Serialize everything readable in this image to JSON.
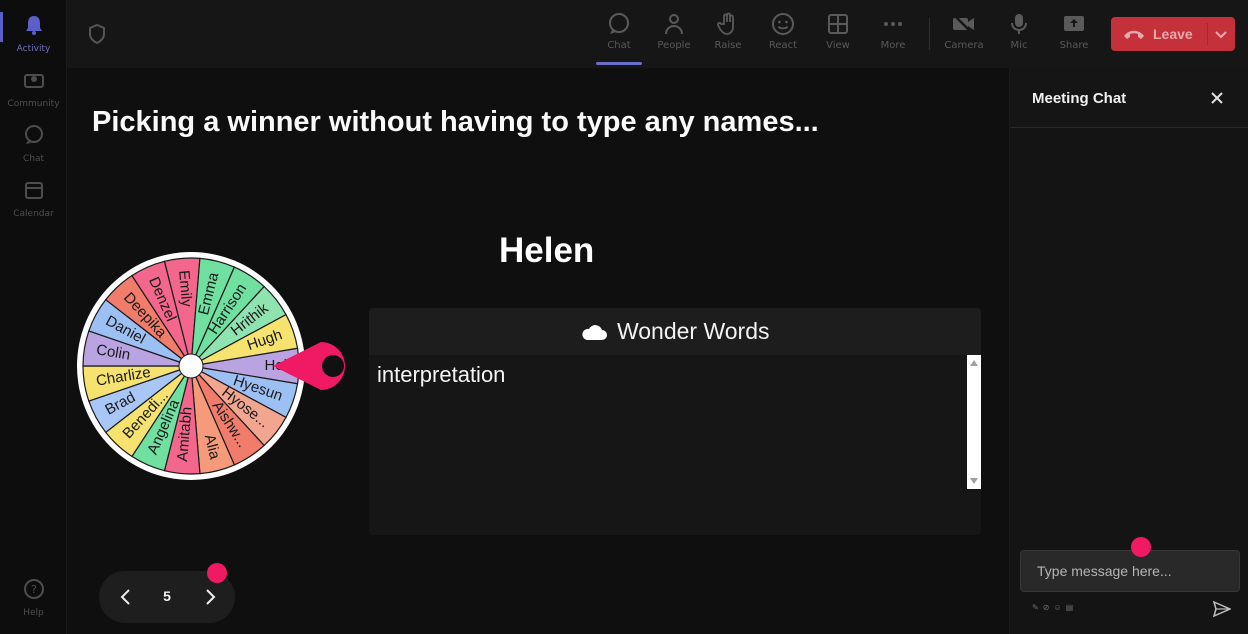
{
  "colors": {
    "accent": "#5b5fc7",
    "leave": "#c4313b",
    "pointer": "#ef1a63",
    "background": "#0f0f0f"
  },
  "rail": {
    "items": [
      {
        "label": "Activity",
        "icon": "bell-icon"
      },
      {
        "label": "Community",
        "icon": "community-icon"
      },
      {
        "label": "Chat",
        "icon": "chat-icon"
      },
      {
        "label": "Calendar",
        "icon": "calendar-icon"
      }
    ],
    "help_label": "Help"
  },
  "toolbar": {
    "buttons": [
      {
        "label": "Chat",
        "icon": "chat-icon"
      },
      {
        "label": "People",
        "icon": "people-icon"
      },
      {
        "label": "Raise",
        "icon": "hand-icon"
      },
      {
        "label": "React",
        "icon": "smile-icon"
      },
      {
        "label": "View",
        "icon": "grid-icon"
      },
      {
        "label": "More",
        "icon": "more-icon"
      },
      {
        "label": "Camera",
        "icon": "camera-off-icon"
      },
      {
        "label": "Mic",
        "icon": "mic-icon"
      },
      {
        "label": "Share",
        "icon": "share-icon"
      }
    ],
    "leave_label": "Leave"
  },
  "stage": {
    "title": "Picking a winner without having to type any names...",
    "winner": "Helen",
    "wheel_names": [
      "Hel",
      "Hyesun",
      "Hyose...",
      "Aishw...",
      "Alia",
      "Amitabh",
      "Angelina",
      "Benedi...",
      "Brad",
      "Charlize",
      "Colin",
      "Daniel",
      "Deepika",
      "Denzel",
      "Emily",
      "Emma",
      "Harrison",
      "Hrithik",
      "Hugh"
    ],
    "wheel_colors": [
      "#b9a3e0",
      "#9dc0f4",
      "#f2a58f",
      "#f27c6c",
      "#f59a7a",
      "#f2678b",
      "#6fe0a0",
      "#f6e26e",
      "#a8c7f7",
      "#f6e26e",
      "#b9a3e0",
      "#9dc0f4",
      "#f27c6c",
      "#f2678b",
      "#f2678b",
      "#6fe0a0",
      "#6fe0a0",
      "#8fe3b0",
      "#f6e26e"
    ],
    "word_panel": {
      "title": "Wonder Words",
      "text": "interpretation"
    },
    "pager": {
      "page": "5"
    }
  },
  "chat": {
    "title": "Meeting Chat",
    "input_placeholder": "Type message here..."
  }
}
